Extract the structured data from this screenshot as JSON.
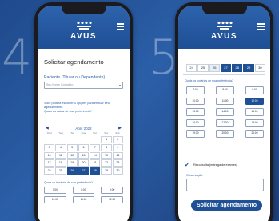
{
  "steps": {
    "left": "4",
    "right": "5"
  },
  "app": {
    "name": "AVUS"
  },
  "screen1": {
    "title": "Solicitar agendamento",
    "patient_label": "Paciente (Titular ou Dependente)",
    "patient_placeholder": "Seu Nome Completo",
    "info_line1": "Você poderá escolher 3 opções para efetuar seu agendamento.",
    "info_line2": "Quais as datas de sua preferência?",
    "calendar": {
      "month": "Abril 2022",
      "weekdays": [
        "Dom",
        "Seg",
        "Ter",
        "Qua",
        "Qui",
        "Sex",
        "Sab"
      ],
      "days": [
        {
          "d": "",
          "sel": false
        },
        {
          "d": "",
          "sel": false
        },
        {
          "d": "",
          "sel": false
        },
        {
          "d": "",
          "sel": false
        },
        {
          "d": "",
          "sel": false
        },
        {
          "d": "1",
          "sel": false
        },
        {
          "d": "2",
          "sel": false
        },
        {
          "d": "3",
          "sel": false
        },
        {
          "d": "4",
          "sel": false
        },
        {
          "d": "5",
          "sel": false
        },
        {
          "d": "6",
          "sel": false
        },
        {
          "d": "7",
          "sel": false
        },
        {
          "d": "8",
          "sel": false
        },
        {
          "d": "9",
          "sel": false
        },
        {
          "d": "10",
          "sel": false
        },
        {
          "d": "11",
          "sel": false
        },
        {
          "d": "12",
          "sel": false
        },
        {
          "d": "13",
          "sel": false
        },
        {
          "d": "14",
          "sel": false
        },
        {
          "d": "15",
          "sel": false
        },
        {
          "d": "16",
          "sel": false
        },
        {
          "d": "17",
          "sel": false
        },
        {
          "d": "18",
          "sel": false
        },
        {
          "d": "19",
          "sel": false
        },
        {
          "d": "20",
          "sel": false
        },
        {
          "d": "21",
          "sel": false
        },
        {
          "d": "22",
          "sel": false
        },
        {
          "d": "23",
          "sel": false
        },
        {
          "d": "24",
          "sel": false
        },
        {
          "d": "25",
          "sel": false
        },
        {
          "d": "26",
          "sel": true
        },
        {
          "d": "27",
          "sel": true
        },
        {
          "d": "28",
          "sel": true
        },
        {
          "d": "29",
          "sel": false
        },
        {
          "d": "30",
          "sel": false
        }
      ]
    },
    "times_question": "Quais os horários de sua preferência?",
    "times": [
      {
        "t": "7:00",
        "sel": false
      },
      {
        "t": "8:00",
        "sel": false
      },
      {
        "t": "9:00",
        "sel": false
      },
      {
        "t": "10:00",
        "sel": false
      },
      {
        "t": "11:00",
        "sel": false
      },
      {
        "t": "12:00",
        "sel": false
      }
    ]
  },
  "screen2": {
    "dates": [
      {
        "d": "24",
        "state": "normal"
      },
      {
        "d": "25",
        "state": "normal"
      },
      {
        "d": "26",
        "state": "dim"
      },
      {
        "d": "27",
        "state": "sel"
      },
      {
        "d": "28",
        "state": "sel"
      },
      {
        "d": "29",
        "state": "sel"
      },
      {
        "d": "30",
        "state": "normal"
      }
    ],
    "times_question": "Quais os horários de sua preferência?",
    "times": [
      {
        "t": "7:00",
        "sel": false
      },
      {
        "t": "8:00",
        "sel": false
      },
      {
        "t": "9:00",
        "sel": false
      },
      {
        "t": "10:00",
        "sel": false
      },
      {
        "t": "11:00",
        "sel": false
      },
      {
        "t": "12:00",
        "sel": true
      },
      {
        "t": "13:00",
        "sel": false
      },
      {
        "t": "14:00",
        "sel": false
      },
      {
        "t": "15:00",
        "sel": false
      },
      {
        "t": "16:00",
        "sel": false
      },
      {
        "t": "17:00",
        "sel": false
      },
      {
        "t": "18:00",
        "sel": false
      },
      {
        "t": "19:00",
        "sel": false
      },
      {
        "t": "20:00",
        "sel": false
      },
      {
        "t": "21:00",
        "sel": false
      }
    ],
    "checkbox_label": "Reconsulta (entrega de exames)",
    "observation_label": "Observação",
    "submit_label": "Solicitar agendamento"
  },
  "colors": {
    "background": "#2b5fa8",
    "brand": "#1f4f95",
    "accent_text": "#2d63ad"
  },
  "icons": [
    "avus-logo-icon",
    "menu-icon",
    "chevron-down-icon",
    "chevron-left-icon",
    "chevron-right-icon",
    "check-icon"
  ]
}
